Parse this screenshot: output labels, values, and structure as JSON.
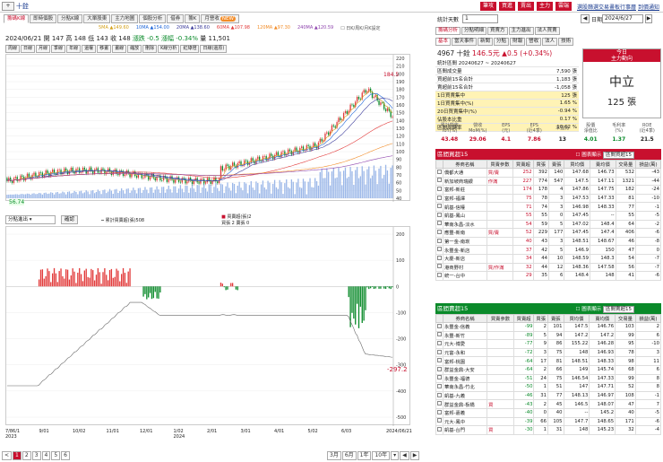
{
  "header": {
    "stock_selector": "+",
    "stock_name": "十銓",
    "red_buttons": [
      "筆攻",
      "買進",
      "賣出",
      "主力",
      "雲端"
    ],
    "links": [
      "選股篩選",
      "交易畫板",
      "行事曆",
      "到價通知"
    ]
  },
  "main_tabs": [
    {
      "label": "籌碼K線",
      "active": true
    },
    {
      "label": "即時個股",
      "active": false
    },
    {
      "label": "分點K線",
      "active": false
    },
    {
      "label": "大單股東",
      "active": false
    },
    {
      "label": "主力地圖",
      "active": false
    },
    {
      "label": "個股分析",
      "active": false
    },
    {
      "label": "借券",
      "active": false
    },
    {
      "label": "籌K",
      "active": false
    },
    {
      "label": "月營收",
      "active": false
    }
  ],
  "main_tab_badge": "NEW",
  "ma_legend": [
    {
      "label": "5MA ▲149.60",
      "color": "#d4a017"
    },
    {
      "label": "10MA ▲154.00",
      "color": "#1e66d9"
    },
    {
      "label": "20MA ▲138.60",
      "color": "#3b3b9b"
    },
    {
      "label": "60MA ▲107.98",
      "color": "#e23a3a"
    },
    {
      "label": "120MA ▲97.30",
      "color": "#f28c28"
    },
    {
      "label": "240MA ▲120.59",
      "color": "#8e44ad"
    }
  ],
  "ma_note": "☐ 日K/周K/月K設定",
  "info_line": {
    "date": "2024/06/21",
    "open": "開 147",
    "high": "高 148",
    "low": "低 143",
    "close": "收 148",
    "change": "漲跌 -0.5",
    "pct": "漲幅 -0.34%",
    "volume": "量 11,501"
  },
  "chart_toolbar": [
    "周線",
    "日線",
    "月線",
    "季線",
    "年線",
    "還權",
    "移畫",
    "畫線",
    "縮放",
    "刪除",
    "K線分析",
    "紅綠燈",
    "日線(還原)"
  ],
  "price_axis": [
    "220",
    "210",
    "200",
    "190",
    "180",
    "170",
    "160",
    "150",
    "140",
    "130",
    "120",
    "110",
    "100",
    "90",
    "80",
    "70",
    "60",
    "50",
    "40"
  ],
  "peak_label": "184.5",
  "low_label": "56.74",
  "sub_toolbar": {
    "select_value": "分點進出",
    "button": "確認",
    "legend_left": "累計買賣超(張)508",
    "legend_right_1": "買賣超(張)2",
    "legend_right_2": "買張 2 賣張 0"
  },
  "sub_axis": [
    "200",
    "100",
    "0",
    "-100",
    "-200",
    "-300",
    "-400",
    "-500"
  ],
  "sub_value_label": "-297.2",
  "x_axis": [
    "7/86/1\n2023",
    "9/01",
    "10/02",
    "11/01",
    "12/01",
    "1/02\n2024",
    "2/01",
    "3/01",
    "4/01",
    "5/02",
    "6/03",
    "2024/06/21"
  ],
  "pager": {
    "pages": [
      "1",
      "2",
      "3",
      "4",
      "5",
      "6"
    ],
    "prev": "<",
    "range": [
      "3月",
      "6月",
      "1年",
      "10年"
    ],
    "nav": [
      "▾",
      "◀",
      "▶"
    ]
  },
  "right": {
    "stat_days_label": "統計天數",
    "stat_days_value": "1",
    "date_label": "日期",
    "date_value": "2024/6/27",
    "tabs": [
      "籌碼分析",
      "分點明細",
      "買賣方",
      "主力進出",
      "法人買賣"
    ],
    "sub_tabs": [
      "基本",
      "當天事件",
      "新聞",
      "分點",
      "財報",
      "營收",
      "法人",
      "技術"
    ],
    "quote": {
      "code_name": "4967 十銓",
      "price": "146.5元",
      "change": "▲0.5 (+0.34%)"
    },
    "chip_rows": [
      {
        "label": "統計區間 20240627 ~ 20240627",
        "value": ""
      },
      {
        "label": "區間成交量",
        "value": "7,590 張"
      },
      {
        "label": "買超前15名合計",
        "value": "1,183 張"
      },
      {
        "label": "賣超前15名合計",
        "value": "-1,058 張"
      },
      {
        "label": "1日買賣集中",
        "value": "125 張"
      },
      {
        "label": "1日買賣集中(%)",
        "value": "1.65 %"
      },
      {
        "label": "20日買賣集中(%)",
        "value": "-0.94 %"
      },
      {
        "label": "佔股本比重",
        "value": "0.17 %"
      },
      {
        "label": "區間周轉率",
        "value": "10.62 %"
      }
    ],
    "today": {
      "title_1": "今日",
      "title_2": "主力動向",
      "state": "中立",
      "amount": "125 張"
    },
    "metrics": [
      {
        "label": "累計營收\nYoY(%)",
        "value": "43.48",
        "cls": "pos"
      },
      {
        "label": "營收\nMoM(%)",
        "value": "29.06",
        "cls": "pos"
      },
      {
        "label": "EPS\n(元)",
        "value": "4.1",
        "cls": "pos"
      },
      {
        "label": "EPS\n(近4季)",
        "value": "7.86",
        "cls": "pos"
      },
      {
        "label": "本益比",
        "value": "13",
        "cls": ""
      },
      {
        "label": "股價\n淨值比",
        "value": "4.01",
        "cls": "neg"
      },
      {
        "label": "毛利率\n(%)",
        "value": "1.37",
        "cls": "neg"
      },
      {
        "label": "ROE\n(近4季)",
        "value": "21.5",
        "cls": ""
      }
    ],
    "buy_section": {
      "title": "區間買超15",
      "ctrl_label": "圖表顯示",
      "ctrl_value": "區間買超15",
      "color": "#c8102e"
    },
    "sell_section": {
      "title": "區間賣超15",
      "ctrl_label": "圖表顯示",
      "ctrl_value": "區間賣超15",
      "color": "#0a8a2a"
    },
    "columns": [
      "",
      "券商名稱",
      "買賣參數",
      "買賣超",
      "買張",
      "賣張",
      "買均價",
      "賣均價",
      "交易量",
      "損益(萬)"
    ],
    "buy_rows": [
      [
        "僑都大通",
        "買/賣",
        "252",
        "392",
        "140",
        "147.68",
        "146.73",
        "532",
        "-43"
      ],
      [
        "新加坡商瑞銀",
        "作滿",
        "227",
        "774",
        "547",
        "147.5",
        "147.11",
        "1321",
        "-44"
      ],
      [
        "富邦-新莊",
        "",
        "174",
        "178",
        "4",
        "147.86",
        "147.75",
        "182",
        "-24"
      ],
      [
        "富邦-福澤",
        "",
        "75",
        "78",
        "3",
        "147.53",
        "147.33",
        "81",
        "-10"
      ],
      [
        "凱基-信權",
        "",
        "71",
        "74",
        "3",
        "146.98",
        "148.33",
        "77",
        "-1"
      ],
      [
        "凱基-鳳山",
        "",
        "55",
        "55",
        "0",
        "147.45",
        "--",
        "55",
        "-5"
      ],
      [
        "華南永昌-淡水",
        "",
        "54",
        "59",
        "5",
        "147.02",
        "148.4",
        "64",
        "-2"
      ],
      [
        "應豐-新南",
        "買/賣",
        "52",
        "229",
        "177",
        "147.45",
        "147.4",
        "406",
        "-6"
      ],
      [
        "第一金-南崁",
        "",
        "40",
        "43",
        "3",
        "148.51",
        "148.67",
        "46",
        "-8"
      ],
      [
        "永豐金-新店",
        "",
        "37",
        "42",
        "5",
        "146.9",
        "150",
        "47",
        "0"
      ],
      [
        "大慶-新店",
        "",
        "34",
        "44",
        "10",
        "148.59",
        "148.3",
        "54",
        "-7"
      ],
      [
        "港商野村",
        "買/作滿",
        "32",
        "44",
        "12",
        "148.36",
        "147.58",
        "56",
        "-7"
      ],
      [
        "統一-台中",
        "",
        "29",
        "35",
        "6",
        "148.4",
        "148",
        "41",
        "-6"
      ]
    ],
    "sell_rows": [
      [
        "永豐金-信義",
        "",
        "-99",
        "2",
        "101",
        "147.5",
        "146.76",
        "103",
        "2"
      ],
      [
        "永豐-新竹",
        "",
        "-89",
        "5",
        "94",
        "147.2",
        "147.2",
        "99",
        "6"
      ],
      [
        "元大-博愛",
        "",
        "-77",
        "9",
        "86",
        "155.22",
        "146.28",
        "95",
        "-10"
      ],
      [
        "元富-永和",
        "",
        "-72",
        "3",
        "75",
        "148",
        "146.93",
        "78",
        "3"
      ],
      [
        "富邦-桃園",
        "",
        "-64",
        "17",
        "81",
        "148.51",
        "148.33",
        "98",
        "11"
      ],
      [
        "群益金鼎-大安",
        "",
        "-64",
        "2",
        "66",
        "149",
        "145.74",
        "68",
        "6"
      ],
      [
        "永豐金-福德",
        "",
        "-51",
        "24",
        "75",
        "146.54",
        "147.33",
        "99",
        "8"
      ],
      [
        "華南永昌-竹北",
        "",
        "-50",
        "1",
        "51",
        "147",
        "147.71",
        "52",
        "8"
      ],
      [
        "凱基-九義",
        "",
        "-46",
        "31",
        "77",
        "148.13",
        "146.97",
        "108",
        "-1"
      ],
      [
        "群益金鼎-板橋",
        "買",
        "-43",
        "2",
        "45",
        "146.5",
        "148.07",
        "47",
        "7"
      ],
      [
        "富邦-嘉義",
        "",
        "-40",
        "0",
        "40",
        "--",
        "145.2",
        "40",
        "-5"
      ],
      [
        "元大-鳳中",
        "",
        "-39",
        "66",
        "105",
        "147.7",
        "148.65",
        "171",
        "-6"
      ],
      [
        "凱基-台門",
        "買",
        "-30",
        "1",
        "31",
        "148",
        "145.23",
        "32",
        "-4"
      ]
    ]
  }
}
